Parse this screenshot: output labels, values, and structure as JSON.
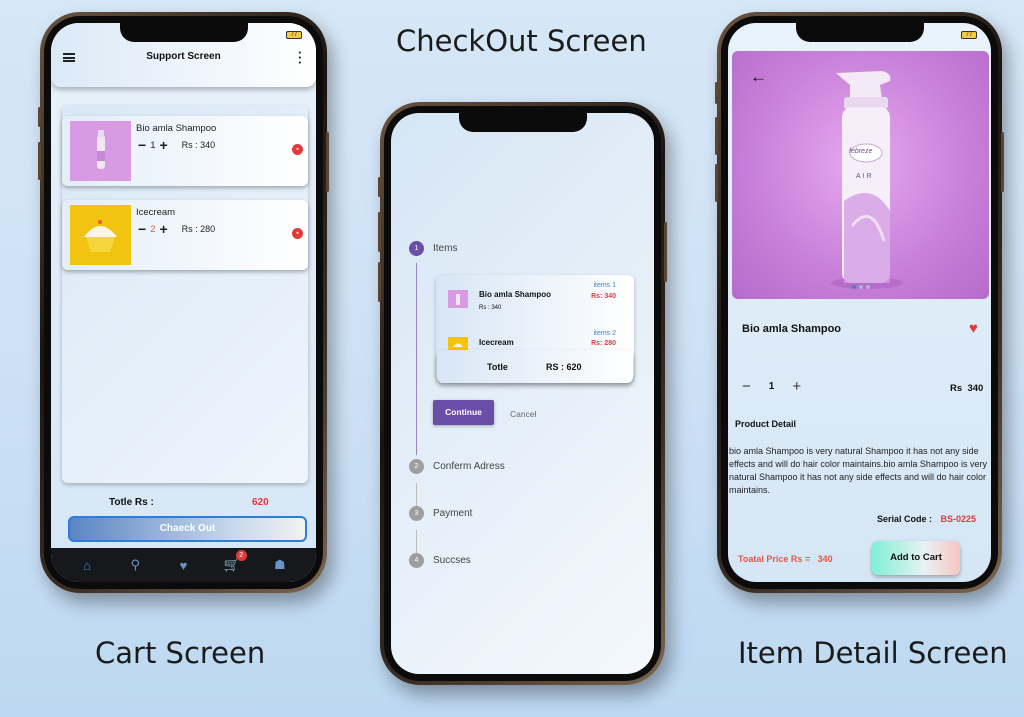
{
  "captions": {
    "checkout": "CheckOut Screen",
    "cart": "Cart Screen",
    "detail": "Item Detail Screen"
  },
  "cart_screen": {
    "battery": "77",
    "title": "Support Screen",
    "items": [
      {
        "name": "Bio amla Shampoo",
        "qty": "1",
        "price": "Rs : 340"
      },
      {
        "name": "Icecream",
        "qty": "2",
        "price": "Rs : 280"
      }
    ],
    "total_label": "Totle Rs :",
    "total_value": "620",
    "checkout_label": "Chaeck Out",
    "nav": [
      "home-icon",
      "search-icon",
      "heart-icon",
      "cart-icon",
      "profile-icon"
    ],
    "cart_badge": "2"
  },
  "checkout_screen": {
    "steps": [
      {
        "num": "1",
        "label": "Items"
      },
      {
        "num": "2",
        "label": "Conferm Adress"
      },
      {
        "num": "3",
        "label": "Payment"
      },
      {
        "num": "4",
        "label": "Succses"
      }
    ],
    "items": [
      {
        "name": "Bio amla Shampoo",
        "price": "Rs : 340",
        "count": "items   1",
        "amount": "Rs: 340"
      },
      {
        "name": "Icecream",
        "price": "",
        "count": "items   2",
        "amount": "Rs: 280"
      }
    ],
    "total_label": "Totle",
    "total_value": "RS : 620",
    "continue_label": "Continue",
    "cancel_label": "Cancel"
  },
  "detail_screen": {
    "battery": "77",
    "product_name": "Bio amla Shampoo",
    "qty": "1",
    "price_label": "Rs",
    "price_value": "340",
    "section_title": "Product Detail",
    "description": "bio amla Shampoo is very natural Shampoo it has not any side effects and will do hair color maintains.bio amla Shampoo is very natural Shampoo it has not any side effects and will do hair color maintains.",
    "serial_label": "Serial Code  :",
    "serial_code": "BS-0225",
    "total_label": "Toatal Price  Rs =",
    "total_value": "340",
    "add_to_cart": "Add to Cart",
    "product_brand": "febreze",
    "product_sub": "AIR"
  },
  "colors": {
    "accent_purple": "#6a4ea8",
    "price_red": "#e03a3a",
    "link_blue": "#3a86d9"
  }
}
